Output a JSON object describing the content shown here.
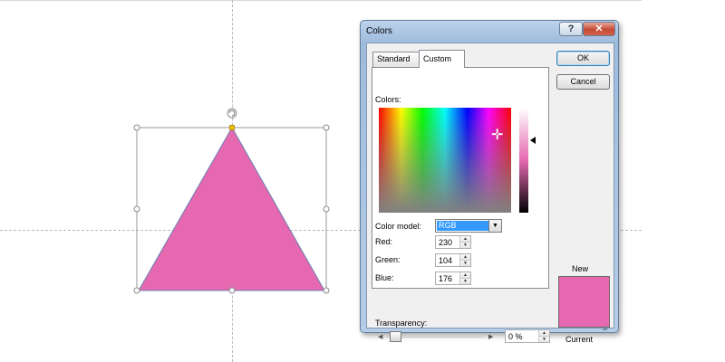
{
  "dialog": {
    "title": "Colors",
    "help_label": "?",
    "close_label": "✕",
    "tabs": [
      {
        "label": "Standard",
        "active": false
      },
      {
        "label": "Custom",
        "active": true
      }
    ],
    "colors_label": "Colors:",
    "color_model_label": "Color model:",
    "color_model_value": "RGB",
    "red_label": "Red:",
    "red_value": "230",
    "green_label": "Green:",
    "green_value": "104",
    "blue_label": "Blue:",
    "blue_value": "176",
    "ok_label": "OK",
    "cancel_label": "Cancel",
    "new_label": "New",
    "current_label": "Current",
    "transparency_label": "Transparency:",
    "transparency_value": "0 %",
    "transparency_level": 0,
    "new_color": "#e668b0",
    "current_color": "#e668b0"
  },
  "shape": {
    "fill": "#e668b0",
    "outline": "#6a7fb0",
    "selection_box_color": "#9a9a9a",
    "rotate_handle_icon": "rotate-handle-icon"
  }
}
